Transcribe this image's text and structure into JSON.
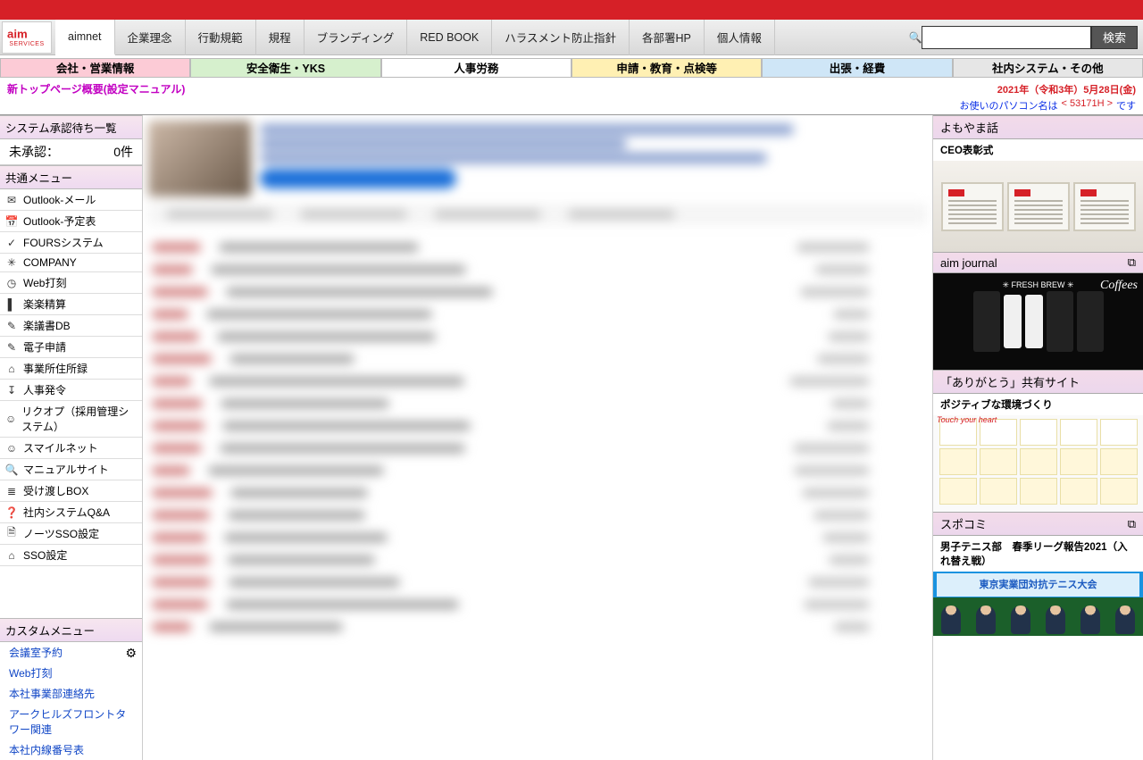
{
  "header": {
    "logo_sub": "SERVICES",
    "tabs": [
      "aimnet",
      "企業理念",
      "行動規範",
      "規程",
      "ブランディング",
      "RED BOOK",
      "ハラスメント防止指針",
      "各部署HP",
      "個人情報"
    ],
    "search_label": "検索"
  },
  "catnav": [
    "会社・営業情報",
    "安全衛生・YKS",
    "人事労務",
    "申請・教育・点検等",
    "出張・経費",
    "社内システム・その他"
  ],
  "badge": "新トップページ概要(設定マニュアル)",
  "dateline": {
    "date": "2021年（令和3年）5月28日(金)",
    "pc_prefix": "お使いのパソコン名は ",
    "pc_name": "< 53171H >",
    "pc_suffix": "です"
  },
  "left": {
    "approval_header": "システム承認待ち一覧",
    "approval_label": "未承認：",
    "approval_count": "0件",
    "common_menu_header": "共通メニュー",
    "common_menu": [
      {
        "icon": "✉",
        "label": "Outlook-メール"
      },
      {
        "icon": "📅",
        "label": "Outlook-予定表"
      },
      {
        "icon": "✓",
        "label": "FOURSシステム"
      },
      {
        "icon": "✳",
        "label": "COMPANY"
      },
      {
        "icon": "◷",
        "label": "Web打刻"
      },
      {
        "icon": "▌",
        "label": "楽楽精算"
      },
      {
        "icon": "✎",
        "label": "楽議書DB"
      },
      {
        "icon": "✎",
        "label": "電子申請"
      },
      {
        "icon": "⌂",
        "label": "事業所住所録"
      },
      {
        "icon": "↧",
        "label": "人事発令"
      },
      {
        "icon": "☺",
        "label": "リクオプ（採用管理システム）"
      },
      {
        "icon": "☺",
        "label": "スマイルネット"
      },
      {
        "icon": "🔍",
        "label": "マニュアルサイト"
      },
      {
        "icon": "≣",
        "label": "受け渡しBOX"
      },
      {
        "icon": "❓",
        "label": "社内システムQ&A"
      },
      {
        "icon": "🗎",
        "label": "ノーツSSO設定"
      },
      {
        "icon": "⌂",
        "label": "SSO設定"
      }
    ],
    "custom_menu_header": "カスタムメニュー",
    "custom_menu": [
      "会議室予約",
      "Web打刻",
      "本社事業部連絡先",
      "アークヒルズフロントタワー関連",
      "本社内線番号表"
    ]
  },
  "right": {
    "box1": {
      "header": "よもやま話",
      "sub": "CEO表彰式"
    },
    "box2": {
      "header": "aim journal"
    },
    "coffee_label": "✳ FRESH BREW ✳",
    "coffee_brand": "Coffees",
    "box3": {
      "header": "「ありがとう」共有サイト",
      "sub": "ポジティブな環境づくり",
      "tag": "Touch your heart"
    },
    "box4": {
      "header": "スポコミ",
      "sub": "男子テニス部　春季リーグ報告2021（入れ替え戦）",
      "banner": "東京実業団対抗テニス大会"
    }
  }
}
